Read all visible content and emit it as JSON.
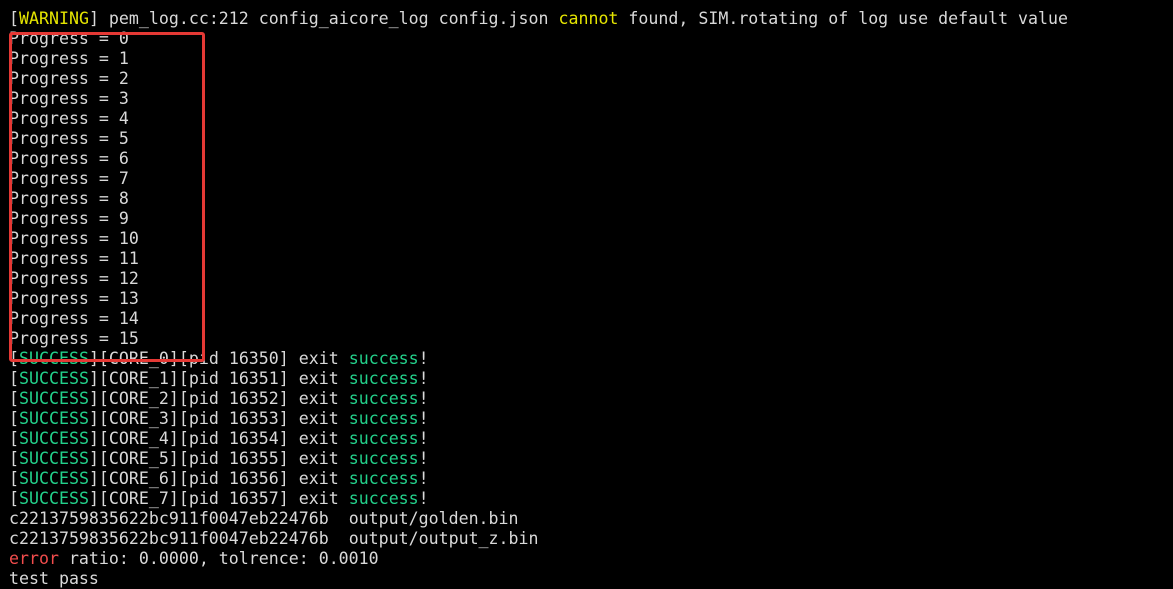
{
  "colors": {
    "background": "#000000",
    "text": "#d9d9d9",
    "warning": "#e5e500",
    "success": "#23d18b",
    "error": "#f14c4c",
    "highlight_border": "#e53935"
  },
  "warning_line": {
    "open_bracket": "[",
    "tag": "WARNING",
    "close_rest": "] pem_log.cc:212 config_aicore_log config.json ",
    "keyword": "cannot",
    "rest": " found, SIM.rotating of log use default value"
  },
  "progress_lines": [
    "Progress = 0",
    "Progress = 1",
    "Progress = 2",
    "Progress = 3",
    "Progress = 4",
    "Progress = 5",
    "Progress = 6",
    "Progress = 7",
    "Progress = 8",
    "Progress = 9",
    "Progress = 10",
    "Progress = 11",
    "Progress = 12",
    "Progress = 13",
    "Progress = 14",
    "Progress = 15"
  ],
  "success_lines": [
    {
      "tag": "SUCCESS",
      "core": "CORE_0",
      "pid": "16350",
      "exit": "exit",
      "word": "success",
      "bang": "!"
    },
    {
      "tag": "SUCCESS",
      "core": "CORE_1",
      "pid": "16351",
      "exit": "exit",
      "word": "success",
      "bang": "!"
    },
    {
      "tag": "SUCCESS",
      "core": "CORE_2",
      "pid": "16352",
      "exit": "exit",
      "word": "success",
      "bang": "!"
    },
    {
      "tag": "SUCCESS",
      "core": "CORE_3",
      "pid": "16353",
      "exit": "exit",
      "word": "success",
      "bang": "!"
    },
    {
      "tag": "SUCCESS",
      "core": "CORE_4",
      "pid": "16354",
      "exit": "exit",
      "word": "success",
      "bang": "!"
    },
    {
      "tag": "SUCCESS",
      "core": "CORE_5",
      "pid": "16355",
      "exit": "exit",
      "word": "success",
      "bang": "!"
    },
    {
      "tag": "SUCCESS",
      "core": "CORE_6",
      "pid": "16356",
      "exit": "exit",
      "word": "success",
      "bang": "!"
    },
    {
      "tag": "SUCCESS",
      "core": "CORE_7",
      "pid": "16357",
      "exit": "exit",
      "word": "success",
      "bang": "!"
    }
  ],
  "checksum_lines": [
    {
      "hash": "c2213759835622bc911f0047eb22476b",
      "file": "output/golden.bin"
    },
    {
      "hash": "c2213759835622bc911f0047eb22476b",
      "file": "output/output_z.bin"
    }
  ],
  "error_line": {
    "word": "error",
    "rest": " ratio: 0.0000, tolrence: 0.0010"
  },
  "final_line": "test pass"
}
